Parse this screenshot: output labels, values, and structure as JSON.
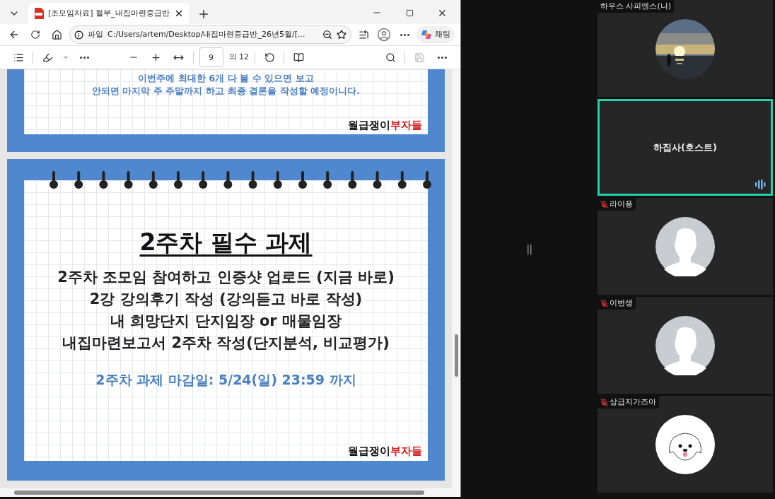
{
  "browser": {
    "tab": {
      "title": "[조모임자료] 월부_내집마련중급반",
      "selected": true
    },
    "address": {
      "scheme_label": "파일",
      "url": "C:/Users/artem/Desktop/내집마련중급반_26년5월/[..."
    },
    "copilot_label": "채팅"
  },
  "pdf_toolbar": {
    "page_input": "9",
    "page_total": "의 12"
  },
  "pages": [
    {
      "kind": "notice",
      "lines": [
        "이번주에 최대한 6개 다 볼 수 있으면 보고",
        "안되면 마지막 주 주말까지 하고 최종 결론을 작성할 예정이니다."
      ],
      "logo": {
        "part_1": "월급쟁이",
        "part_2": "부자들"
      }
    },
    {
      "kind": "task",
      "title": "2주차 필수 과제",
      "lines": [
        "2주차 조모임 참여하고 인증샷 업로드 (지금 바로)",
        "2강 강의후기 작성 (강의듣고 바로 작성)",
        "내 희망단지 단지임장 or 매물임장",
        "내집마련보고서 2주차 작성(단지분석, 비교평가)"
      ],
      "deadline": "2주차 과제 마감일: 5/24(일) 23:59 까지",
      "logo": {
        "part_1": "월급쟁이",
        "part_2": "부자들"
      }
    }
  ],
  "participants": [
    {
      "name": "하우스 사피엔스(나)",
      "kind": "picture",
      "muted": false,
      "speaking": false
    },
    {
      "name": "하집사(호스트)",
      "kind": "name_only",
      "muted": false,
      "speaking": true
    },
    {
      "name": "라이퐁",
      "kind": "silhouette",
      "muted": true,
      "speaking": false
    },
    {
      "name": "이번생",
      "kind": "silhouette",
      "muted": true,
      "speaking": false
    },
    {
      "name": "상급지가즈아",
      "kind": "dog",
      "muted": true,
      "speaking": false
    }
  ]
}
